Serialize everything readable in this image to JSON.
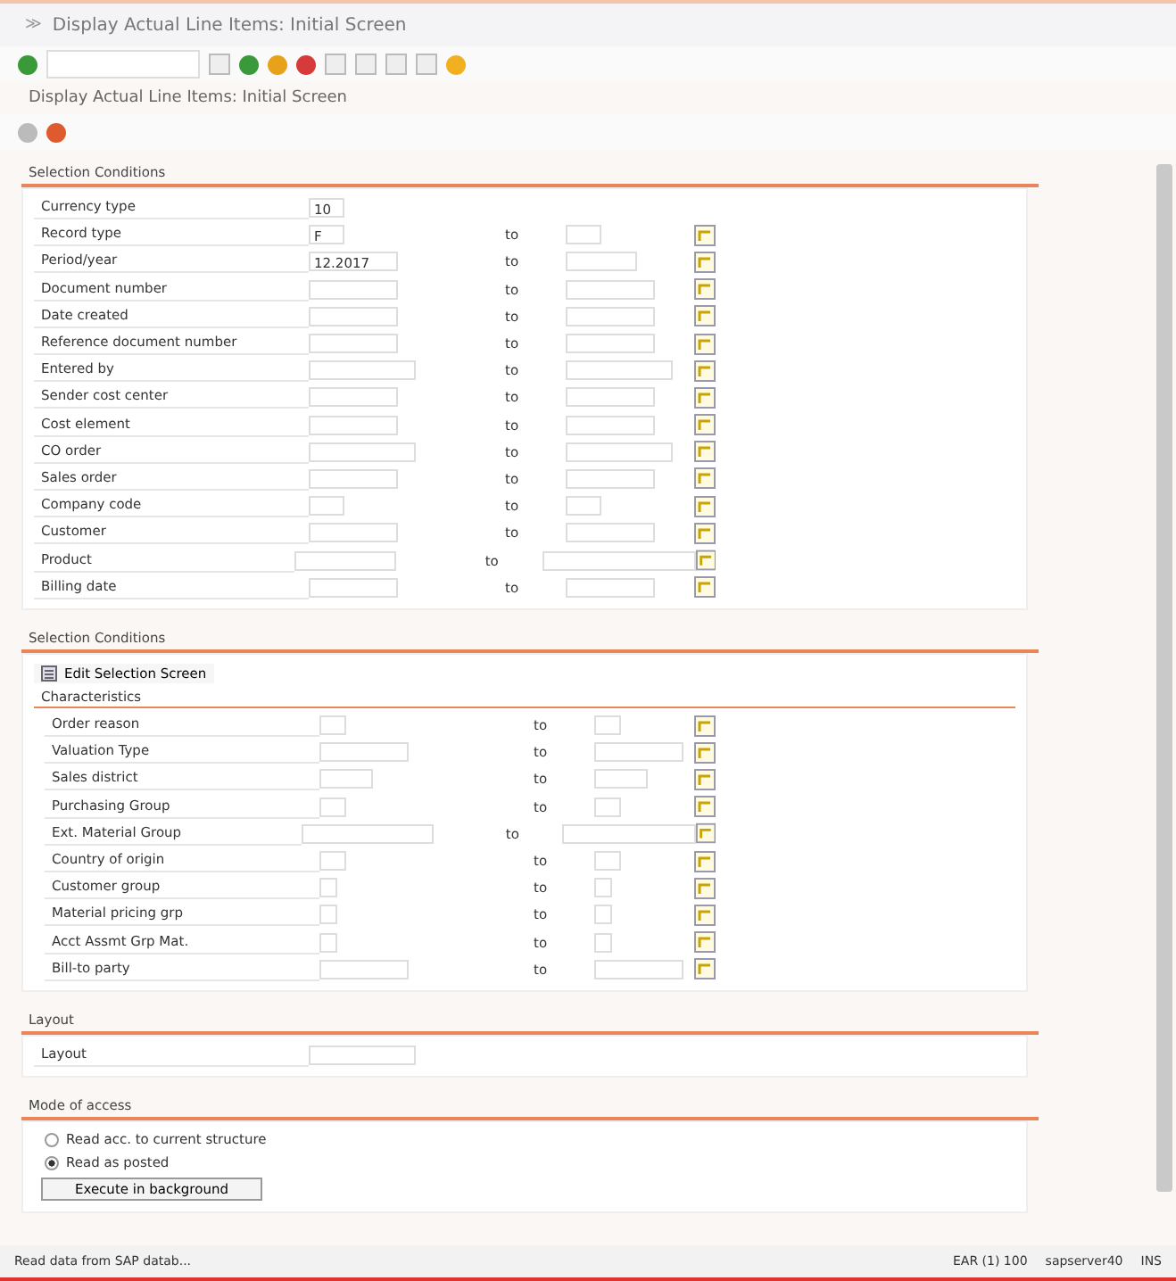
{
  "window": {
    "menu_glyph": "≫",
    "title": "Display Actual Line Items: Initial Screen"
  },
  "screen_title": "Display Actual Line Items: Initial Screen",
  "selection": {
    "title": "Selection Conditions",
    "fields": [
      {
        "label": "Currency type",
        "value": "10"
      },
      {
        "label": "Record type",
        "value": "F",
        "to": "to"
      },
      {
        "label": "Period/year",
        "value": "12.2017",
        "to": "to"
      },
      {
        "label": "Document number",
        "to": "to"
      },
      {
        "label": "Date created",
        "to": "to"
      },
      {
        "label": "Reference document number",
        "to": "to"
      },
      {
        "label": "Entered by",
        "to": "to"
      },
      {
        "label": "Sender cost center",
        "to": "to"
      },
      {
        "label": "Cost element",
        "to": "to"
      },
      {
        "label": "CO order",
        "to": "to"
      },
      {
        "label": "Sales order",
        "to": "to"
      },
      {
        "label": "Company code",
        "to": "to"
      },
      {
        "label": "Customer",
        "to": "to"
      },
      {
        "label": "Product",
        "to": "to"
      },
      {
        "label": "Billing date",
        "to": "to"
      }
    ]
  },
  "selection2": {
    "title": "Selection Conditions",
    "edit_button": "Edit Selection Screen",
    "subtitle": "Characteristics",
    "fields": [
      {
        "label": "Order reason",
        "to": "to"
      },
      {
        "label": "Valuation Type",
        "to": "to"
      },
      {
        "label": "Sales district",
        "to": "to"
      },
      {
        "label": "Purchasing Group",
        "to": "to"
      },
      {
        "label": "Ext. Material Group",
        "to": "to"
      },
      {
        "label": "Country of origin",
        "to": "to"
      },
      {
        "label": "Customer group",
        "to": "to"
      },
      {
        "label": "Material pricing grp",
        "to": "to"
      },
      {
        "label": "Acct Assmt Grp Mat.",
        "to": "to"
      },
      {
        "label": "Bill-to party",
        "to": "to"
      }
    ]
  },
  "layout": {
    "title": "Layout",
    "label": "Layout"
  },
  "mode": {
    "title": "Mode of access",
    "options": [
      {
        "label": "Read acc. to current structure",
        "selected": false
      },
      {
        "label": "Read as posted",
        "selected": true
      }
    ],
    "button": "Execute in background"
  },
  "status_bar": {
    "message": "Read data from SAP datab...",
    "system": "EAR (1) 100",
    "server": "sapserver40",
    "mode": "INS"
  }
}
